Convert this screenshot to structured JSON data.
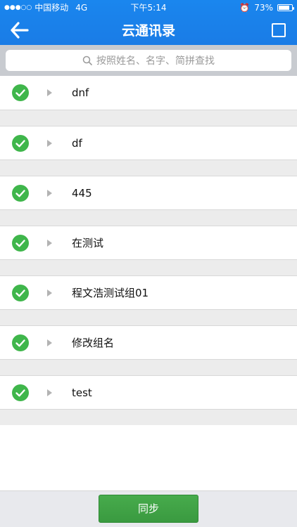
{
  "status_bar": {
    "signal": "●●●○○",
    "carrier": "中国移动",
    "network": "4G",
    "time": "下午5:14",
    "battery_percent": "73%",
    "battery_level": 0.73
  },
  "nav": {
    "title": "云通讯录"
  },
  "search": {
    "placeholder": "按照姓名、名字、简拼查找"
  },
  "groups": [
    {
      "name": "dnf",
      "checked": true
    },
    {
      "name": "df",
      "checked": true
    },
    {
      "name": "445",
      "checked": true
    },
    {
      "name": "在测试",
      "checked": true
    },
    {
      "name": "程文浩测试组01",
      "checked": true
    },
    {
      "name": "修改组名",
      "checked": true
    },
    {
      "name": "test",
      "checked": true
    }
  ],
  "footer": {
    "sync_label": "同步"
  },
  "colors": {
    "nav_blue": "#1a80ea",
    "check_green": "#3fb64b",
    "sync_green": "#42a347"
  }
}
